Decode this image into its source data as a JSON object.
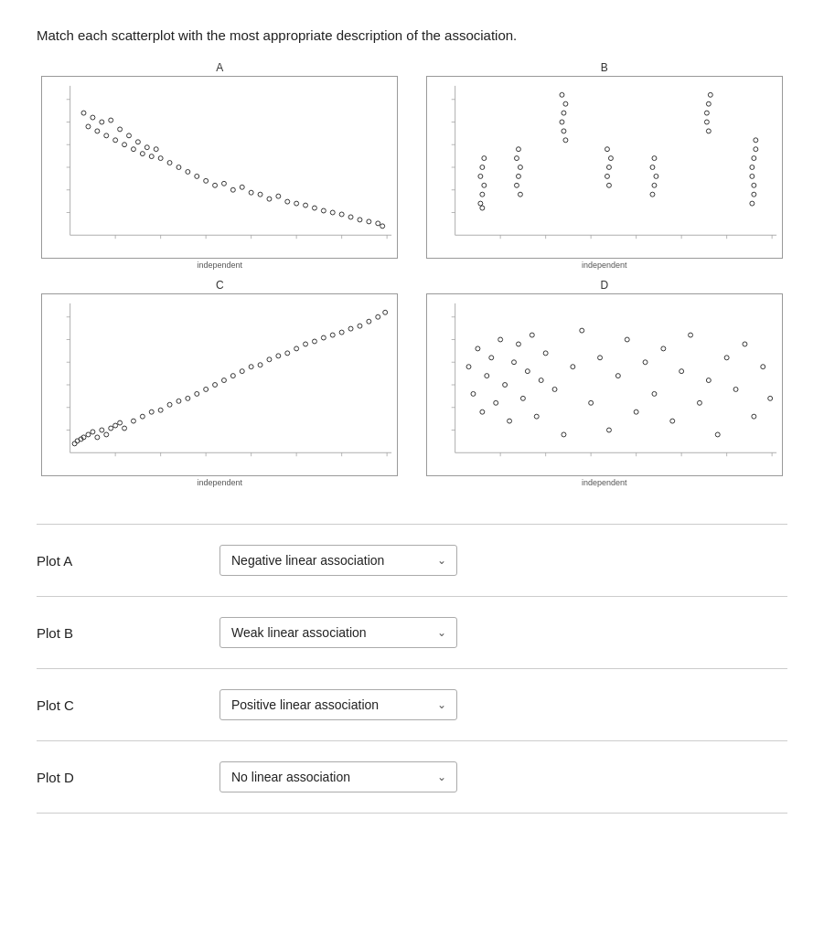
{
  "instruction": "Match each scatterplot with the most appropriate description of the association.",
  "plots": [
    {
      "id": "A",
      "label": "A",
      "type": "negative",
      "xlabel": "independent"
    },
    {
      "id": "B",
      "label": "B",
      "type": "weak",
      "xlabel": "independent"
    },
    {
      "id": "C",
      "label": "C",
      "type": "positive",
      "xlabel": "independent"
    },
    {
      "id": "D",
      "label": "D",
      "type": "none",
      "xlabel": "independent"
    }
  ],
  "matching": [
    {
      "plot": "Plot A",
      "selected": "Negative linear association",
      "options": [
        "Negative linear association",
        "Weak linear association",
        "Positive linear association",
        "No linear association"
      ]
    },
    {
      "plot": "Plot B",
      "selected": "Weak linear association",
      "options": [
        "Negative linear association",
        "Weak linear association",
        "Positive linear association",
        "No linear association"
      ]
    },
    {
      "plot": "Plot C",
      "selected": "Positive linear association",
      "options": [
        "Negative linear association",
        "Weak linear association",
        "Positive linear association",
        "No linear association"
      ]
    },
    {
      "plot": "Plot D",
      "selected": "No linear association",
      "options": [
        "Negative linear association",
        "Weak linear association",
        "Positive linear association",
        "No linear association"
      ]
    }
  ]
}
